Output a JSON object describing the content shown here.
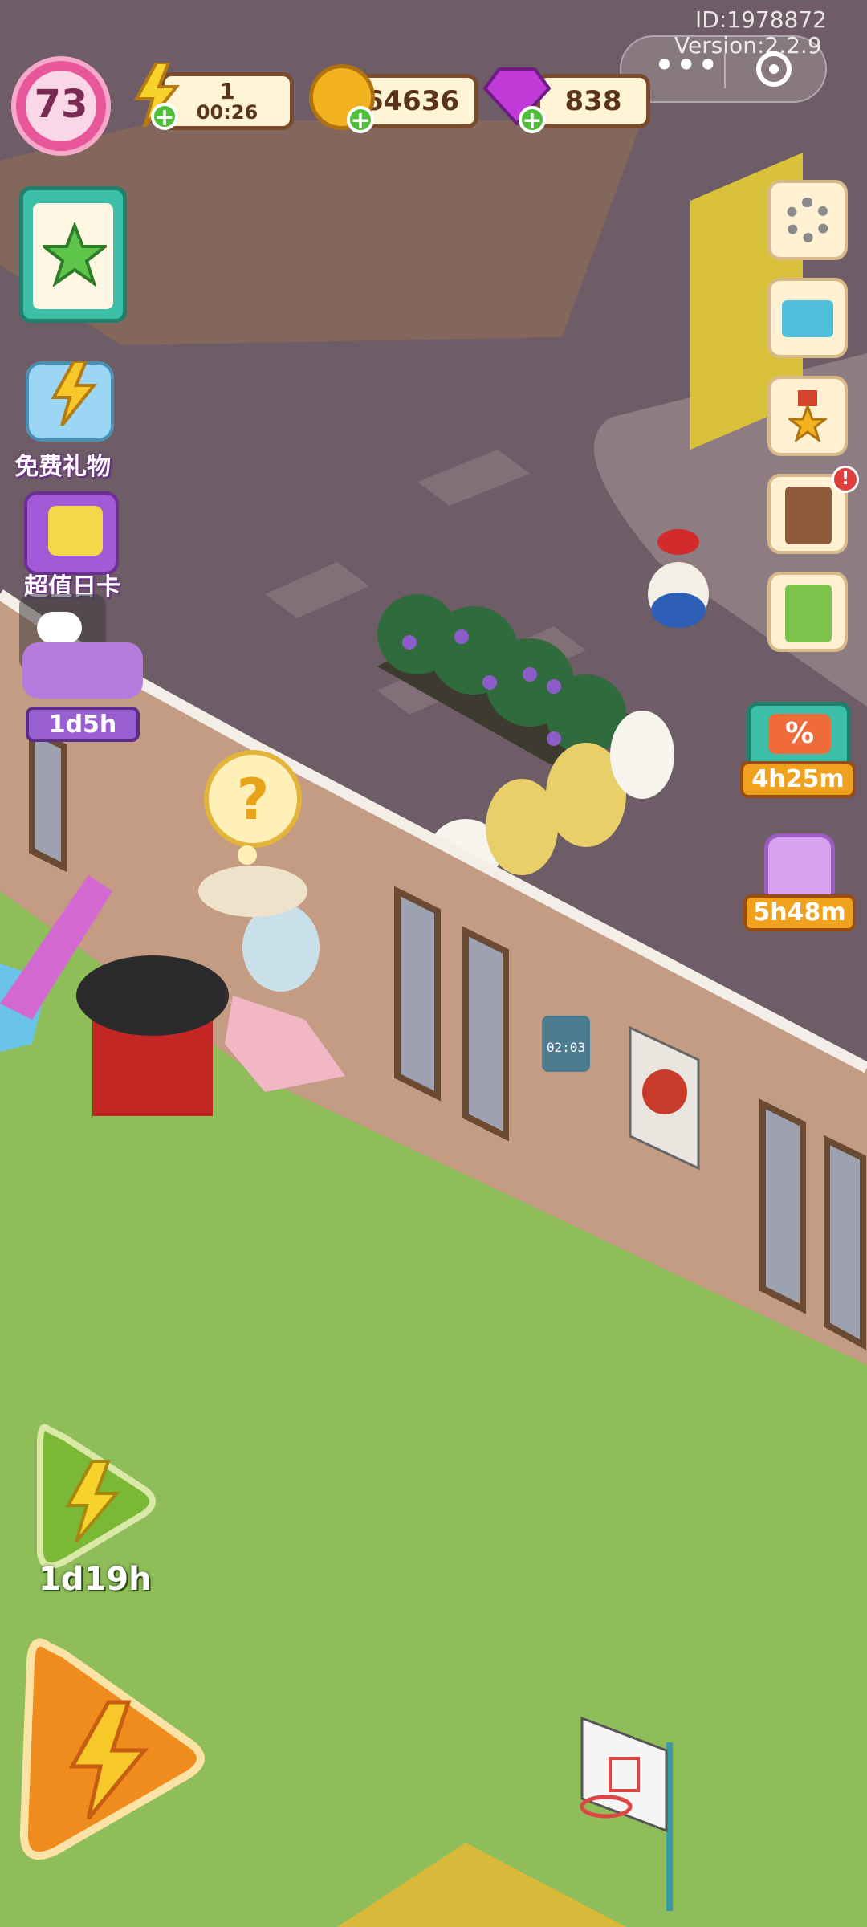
{
  "meta": {
    "id_text": "ID:1978872",
    "version_text": "Version:2.2.9"
  },
  "top_bar": {
    "level": "73",
    "energy": {
      "value": "1",
      "timer": "00:26"
    },
    "coins": "64636",
    "gems": "838"
  },
  "left_menu": {
    "free_gift_label": "免费礼物",
    "daily_card_label": "超值日卡",
    "event_timer": "1d5h"
  },
  "right_menu": {
    "sale_timer": "4h25m",
    "jar_timer": "5h48m"
  },
  "bottom_left": {
    "boost_timer": "1d19h"
  },
  "scene": {
    "clock_text": "02:03",
    "question_mark": "?"
  },
  "colors": {
    "level_ring": "#e8579a",
    "coin": "#f2b31f",
    "gem": "#c03bd8",
    "energy": "#f6d22a",
    "grass": "#8fbd5a",
    "street": "#6b5a62"
  },
  "icons": [
    "lightning-icon",
    "coin-icon",
    "gem-icon",
    "star-clipboard-icon",
    "gear-icon",
    "mail-icon",
    "medal-icon",
    "book-icon",
    "recipe-book-icon",
    "chat-icon",
    "discount-icon",
    "jar-icon",
    "menu-dots-icon",
    "close-circle-icon"
  ]
}
